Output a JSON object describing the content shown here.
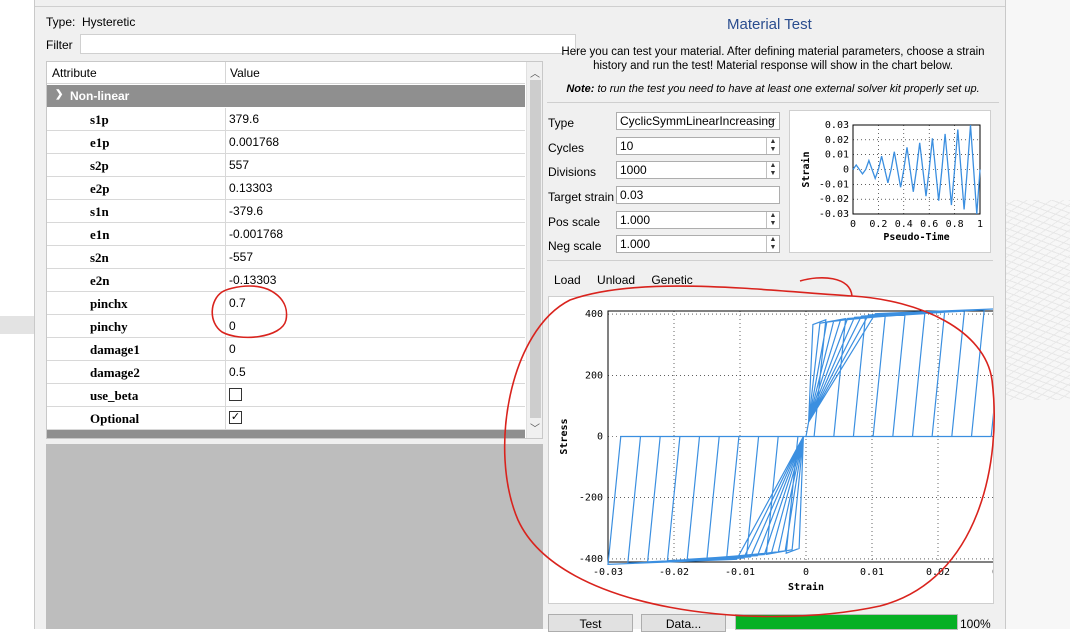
{
  "left": {
    "type_label": "Type:",
    "type_value": "Hysteretic",
    "filter_label": "Filter",
    "columns": [
      "Attribute",
      "Value"
    ],
    "category": "Non-linear",
    "rows": [
      {
        "k": "s1p",
        "v": "379.6"
      },
      {
        "k": "e1p",
        "v": "0.001768"
      },
      {
        "k": "s2p",
        "v": "557"
      },
      {
        "k": "e2p",
        "v": "0.13303"
      },
      {
        "k": "s1n",
        "v": "-379.6"
      },
      {
        "k": "e1n",
        "v": "-0.001768"
      },
      {
        "k": "s2n",
        "v": "-557"
      },
      {
        "k": "e2n",
        "v": "-0.13303"
      },
      {
        "k": "pinchx",
        "v": "0.7"
      },
      {
        "k": "pinchy",
        "v": "0"
      },
      {
        "k": "damage1",
        "v": "0"
      },
      {
        "k": "damage2",
        "v": "0.5"
      },
      {
        "k": "use_beta",
        "v": ""
      },
      {
        "k": "Optional",
        "v": "✓"
      }
    ]
  },
  "right": {
    "title": "Material Test",
    "description": "Here you can test your material. After defining material parameters, choose a strain history and run the test! Material response will show in the chart below.",
    "note_bold": "Note:",
    "note_text": " to run the test you need to have at least one external solver kit properly set up.",
    "fields": {
      "type_label": "Type",
      "type_value": "CyclicSymmLinearIncreasing",
      "cycles_label": "Cycles",
      "cycles_value": "10",
      "divisions_label": "Divisions",
      "divisions_value": "1000",
      "target_label": "Target strain",
      "target_value": "0.03",
      "pos_label": "Pos scale",
      "pos_value": "1.000",
      "neg_label": "Neg scale",
      "neg_value": "1.000"
    },
    "tabs": [
      "Load",
      "Unload",
      "Genetic"
    ],
    "test_button": "Test",
    "data_button": "Data...",
    "progress": 100,
    "progress_label": "100%"
  },
  "chart_data": [
    {
      "type": "line",
      "xlabel": "Pseudo-Time",
      "ylabel": "Strain",
      "xlim": [
        0,
        1
      ],
      "ylim": [
        -0.03,
        0.03
      ],
      "xticks": [
        "0",
        "0.2",
        "0.4",
        "0.6",
        "0.8",
        "1"
      ],
      "yticks": [
        "0.03",
        "0.02",
        "0.01",
        "0",
        "-0.01",
        "-0.02",
        "-0.03"
      ],
      "series": [
        {
          "x": [
            0,
            0.025,
            0.075,
            0.1,
            0.125,
            0.175,
            0.2,
            0.225,
            0.275,
            0.3,
            0.325,
            0.375,
            0.4,
            0.425,
            0.475,
            0.5,
            0.525,
            0.575,
            0.6,
            0.625,
            0.675,
            0.7,
            0.725,
            0.775,
            0.8,
            0.825,
            0.875,
            0.9,
            0.925,
            0.975,
            1.0
          ],
          "y": [
            0,
            0.003,
            -0.003,
            0,
            0.006,
            -0.006,
            0,
            0.009,
            -0.009,
            0,
            0.012,
            -0.012,
            0,
            0.015,
            -0.015,
            0,
            0.018,
            -0.018,
            0,
            0.021,
            -0.021,
            0,
            0.024,
            -0.024,
            0,
            0.027,
            -0.027,
            0,
            0.03,
            -0.03,
            0
          ],
          "color": "#3b8fe0"
        }
      ]
    },
    {
      "type": "line",
      "xlabel": "Strain",
      "ylabel": "Stress",
      "xlim": [
        -0.03,
        0.03
      ],
      "ylim": [
        -420,
        420
      ],
      "xticks": [
        "-0.03",
        "-0.02",
        "-0.01",
        "0",
        "0.01",
        "0.02",
        "0.03"
      ],
      "yticks": [
        "400",
        "200",
        "0",
        "-200",
        "-400"
      ],
      "grid": true,
      "series": [
        {
          "name": "",
          "color": "#3b8fe0"
        }
      ]
    }
  ]
}
